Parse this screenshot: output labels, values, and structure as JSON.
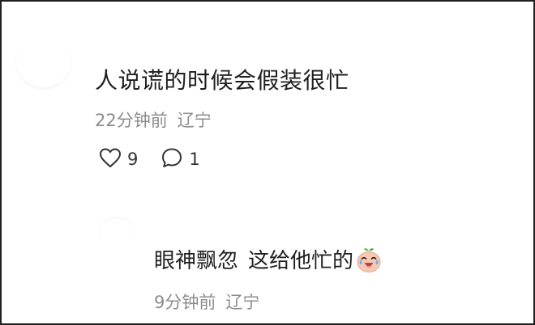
{
  "comment": {
    "text": "人说谎的时候会假装很忙",
    "time": "22分钟前",
    "location": "辽宁",
    "likes": "9",
    "replies": "1"
  },
  "reply": {
    "text_part1": "眼神飘忽",
    "text_part2": "这给他忙的",
    "emoji_icon": "crying-laughing-emoji-icon",
    "time": "9分钟前",
    "location": "辽宁"
  }
}
